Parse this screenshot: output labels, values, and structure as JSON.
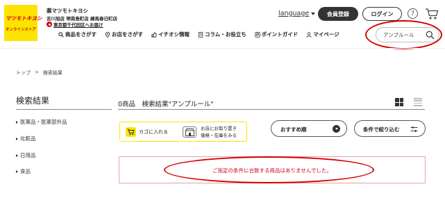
{
  "header": {
    "logo": {
      "line1": "マツモトキヨシ",
      "line2": "オンラインストア"
    },
    "store_name": "薬マツモトキヨシ",
    "store_address": "吉川旭店 堺南島町店 練馬春日町店",
    "delivery_text": "東京都千代田区へお届け",
    "language_label": "language",
    "register_label": "会員登録",
    "login_label": "ログイン",
    "help_label": "?",
    "search": {
      "value": "アンプルール"
    }
  },
  "nav": {
    "items": [
      {
        "label": "商品をさがす",
        "icon": "search-icon"
      },
      {
        "label": "お店をさがす",
        "icon": "map-pin-icon"
      },
      {
        "label": "イチオシ情報",
        "icon": "thumbs-up-icon"
      },
      {
        "label": "コラム・お役立ち",
        "icon": "document-icon"
      },
      {
        "label": "ポイントガイド",
        "icon": "point-icon"
      },
      {
        "label": "マイページ",
        "icon": "user-icon"
      }
    ]
  },
  "breadcrumb": {
    "items": [
      "トップ",
      ">",
      "検索結果"
    ]
  },
  "sidebar": {
    "title": "検索結果",
    "categories": [
      "医薬品・医薬部外品",
      "化粧品",
      "日用品",
      "食品"
    ]
  },
  "main": {
    "result_title": "0商品　検索結果\"アンプルール\"",
    "legend_cart": "カゴに入れる",
    "legend_store_line1": "お店にお取り置き",
    "legend_store_line2": "価格・在庫をみる",
    "sort_label": "おすすめ順",
    "filter_label": "条件で絞り込む",
    "empty_message": "ご指定の条件に合致する商品はありませんでした。"
  },
  "colors": {
    "brand_yellow": "#fde400",
    "brand_red": "#d40000",
    "error_text": "#d0021b"
  }
}
